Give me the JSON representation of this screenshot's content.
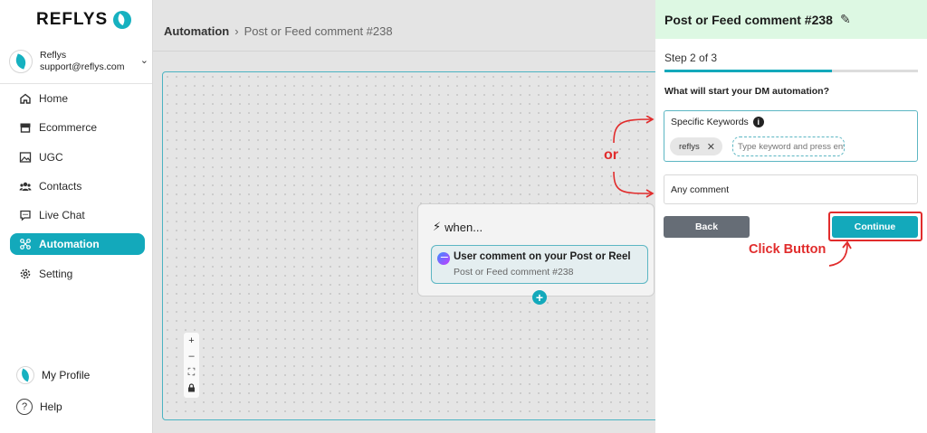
{
  "brand": {
    "name": "REFLYS"
  },
  "account": {
    "name": "Reflys",
    "email": "support@reflys.com"
  },
  "sidebar": {
    "items": [
      {
        "label": "Home",
        "icon": "home-icon"
      },
      {
        "label": "Ecommerce",
        "icon": "store-icon"
      },
      {
        "label": "UGC",
        "icon": "image-icon"
      },
      {
        "label": "Contacts",
        "icon": "users-icon"
      },
      {
        "label": "Live Chat",
        "icon": "chat-icon"
      },
      {
        "label": "Automation",
        "icon": "automation-icon",
        "active": true
      },
      {
        "label": "Setting",
        "icon": "gear-icon"
      }
    ],
    "profile_label": "My Profile",
    "help_label": "Help"
  },
  "breadcrumb": {
    "root": "Automation",
    "current": "Post or Feed comment #238"
  },
  "canvas": {
    "when_label": "when...",
    "trigger_title": "User comment on your Post or Reel",
    "trigger_subtitle": "Post or Feed comment #238"
  },
  "annotations": {
    "or": "or",
    "click": "Click Button"
  },
  "panel": {
    "title": "Post or Feed comment #238",
    "step_label": "Step 2 of 3",
    "progress": 0.66,
    "question": "What will start your DM automation?",
    "keywords_label": "Specific Keywords",
    "keyword_chip": "reflys",
    "keyword_placeholder": "Type keyword and press enter",
    "any_comment_label": "Any comment",
    "back_label": "Back",
    "continue_label": "Continue"
  },
  "colors": {
    "accent": "#13a9bb",
    "annotation": "#e12c2c",
    "header_bg": "#ddf8e3"
  }
}
